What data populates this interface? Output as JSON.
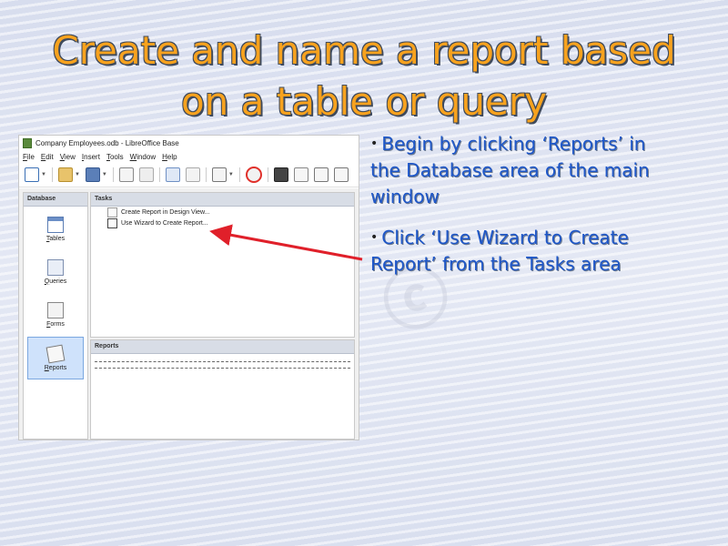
{
  "slide": {
    "title_line1": "Create and name a report based",
    "title_line2": "on a table or query",
    "bullets": [
      "Begin by clicking ‘Reports’ in the Database area of the main window",
      "Click ‘Use Wizard to Create Report’ from the Tasks area"
    ]
  },
  "window": {
    "title": "Company Employees.odb - LibreOffice Base",
    "menu": [
      "File",
      "Edit",
      "View",
      "Insert",
      "Tools",
      "Window",
      "Help"
    ],
    "database": {
      "header": "Database",
      "items": [
        {
          "label": "Tables",
          "icon": "tables-icon"
        },
        {
          "label": "Queries",
          "icon": "queries-icon"
        },
        {
          "label": "Forms",
          "icon": "forms-icon"
        },
        {
          "label": "Reports",
          "icon": "reports-icon",
          "selected": true
        }
      ]
    },
    "tasks": {
      "header": "Tasks",
      "items": [
        "Create Report in Design View...",
        "Use Wizard to Create Report..."
      ]
    },
    "reports": {
      "header": "Reports"
    }
  },
  "colors": {
    "title": "#f7a21e",
    "bullet_text": "#1e57c9",
    "arrow": "#e0202a"
  }
}
